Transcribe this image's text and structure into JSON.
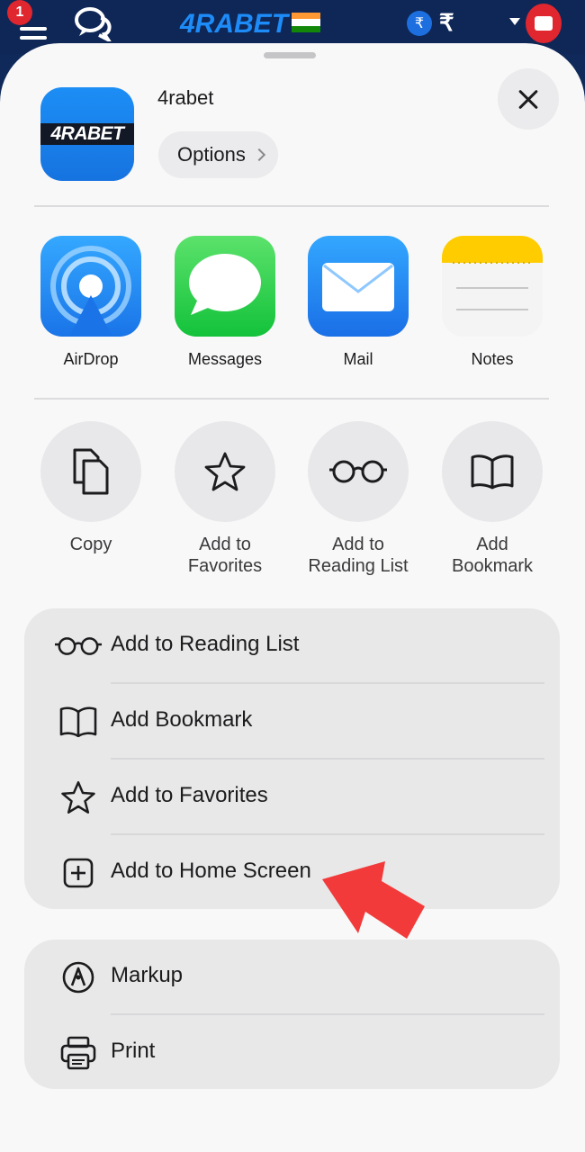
{
  "topbar": {
    "notification_count": "1",
    "logo": "4RABET",
    "currency_symbol": "₹",
    "balance_symbol": "₹",
    "icons": [
      "menu-icon",
      "chat-icon",
      "india-flag-icon",
      "rupee-icon",
      "wallet-icon"
    ]
  },
  "header": {
    "app_icon_text": "4RABET",
    "title": "4rabet",
    "options_label": "Options"
  },
  "share_apps": [
    {
      "label": "AirDrop",
      "icon": "airdrop-icon"
    },
    {
      "label": "Messages",
      "icon": "messages-icon"
    },
    {
      "label": "Mail",
      "icon": "mail-icon"
    },
    {
      "label": "Notes",
      "icon": "notes-icon"
    }
  ],
  "actions": [
    {
      "line1": "Copy",
      "line2": "",
      "icon": "copy-icon"
    },
    {
      "line1": "Add to",
      "line2": "Favorites",
      "icon": "star-icon"
    },
    {
      "line1": "Add to",
      "line2": "Reading List",
      "icon": "glasses-icon"
    },
    {
      "line1": "Add",
      "line2": "Bookmark",
      "icon": "book-icon"
    }
  ],
  "group1": [
    {
      "label": "Add to Reading List",
      "icon": "glasses-icon"
    },
    {
      "label": "Add Bookmark",
      "icon": "book-icon"
    },
    {
      "label": "Add to Favorites",
      "icon": "star-icon"
    },
    {
      "label": "Add to Home Screen",
      "icon": "plus-square-icon"
    }
  ],
  "group2": [
    {
      "label": "Markup",
      "icon": "markup-icon"
    },
    {
      "label": "Print",
      "icon": "printer-icon"
    }
  ],
  "colors": {
    "topbar_bg": "#0e2757",
    "sheet_bg": "#f8f8f8",
    "group_bg": "#e8e8e8",
    "arrow": "#f23a3a",
    "brand_blue": "#1d8cf8"
  }
}
